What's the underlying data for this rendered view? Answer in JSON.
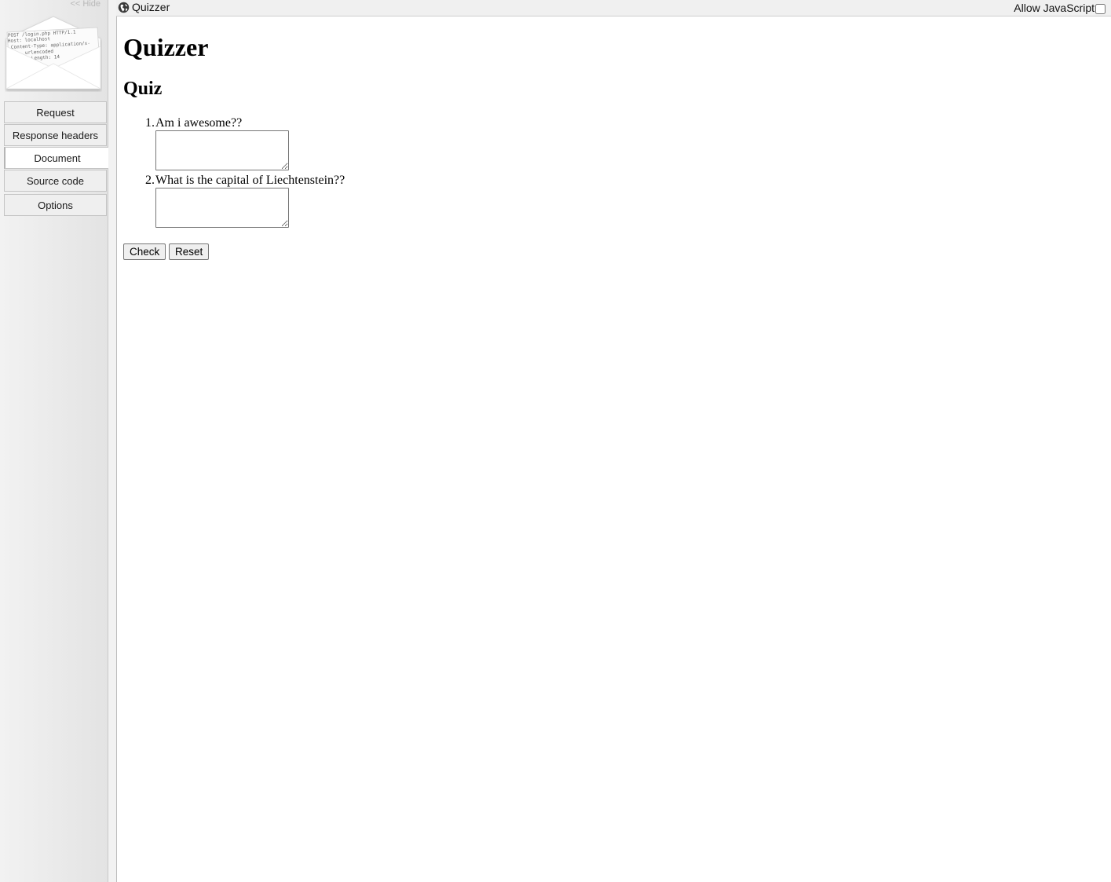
{
  "sidebar": {
    "hide_label": "<< Hide",
    "logo_lines": [
      "POST /login.php HTTP/1.1",
      "Host: localhost",
      "Content-Type: application/x-",
      "urlencoded",
      "Length: 14"
    ],
    "nav": [
      {
        "label": "Request",
        "active": false
      },
      {
        "label": "Response headers",
        "active": false
      },
      {
        "label": "Document",
        "active": true
      },
      {
        "label": "Source code",
        "active": false
      },
      {
        "label": "Options",
        "active": false
      }
    ]
  },
  "topbar": {
    "page_title": "Quizzer",
    "allow_js_label": "Allow JavaScript",
    "allow_js_checked": false,
    "icon": "globe-icon"
  },
  "document": {
    "heading": "Quizzer",
    "subheading": "Quiz",
    "questions": [
      {
        "number": "1.",
        "text": "Am i awesome??",
        "answer": ""
      },
      {
        "number": "2.",
        "text": "What is the capital of Liechtenstein??",
        "answer": ""
      }
    ],
    "check_label": "Check",
    "reset_label": "Reset"
  }
}
